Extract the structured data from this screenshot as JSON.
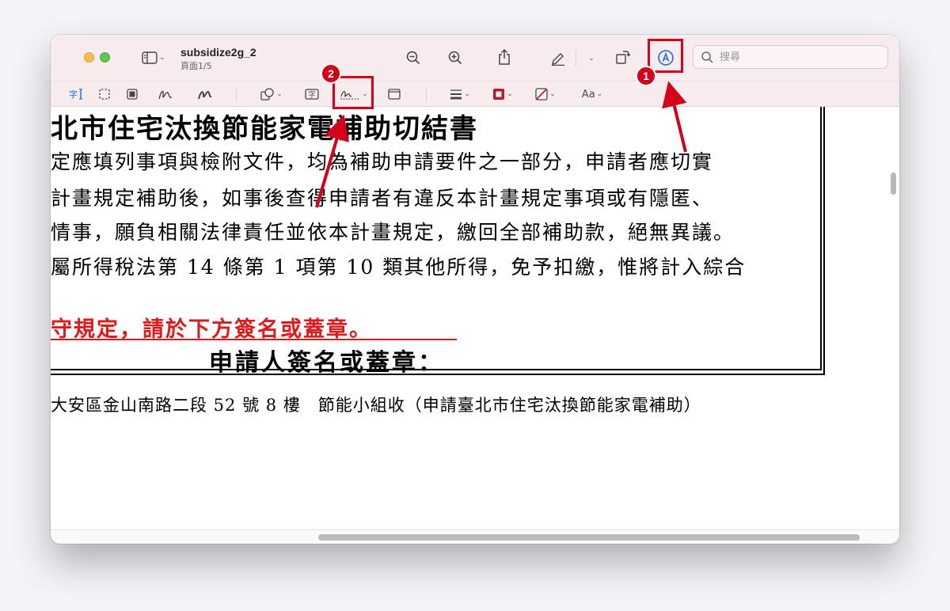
{
  "window": {
    "doc_title": "subsidize2g_2",
    "page_indicator": "頁面1/5",
    "search_placeholder": "搜尋"
  },
  "icons": {
    "sidebar": "sidebar-icon",
    "zoom_out": "zoom-out-icon",
    "zoom_in": "zoom-in-icon",
    "share": "share-icon",
    "highlight": "highlighter-icon",
    "rotate": "rotate-icon",
    "markup": "markup-pen-icon",
    "search": "search-icon"
  },
  "markup_toolbar": {
    "font_button": "Aa"
  },
  "document": {
    "heading": "北市住宅汰換節能家電補助切結書",
    "para1": "定應填列事項與檢附文件，均為補助申請要件之一部分，申請者應切實",
    "para2": "計畫規定補助後，如事後查得申請者有違反本計畫規定事項或有隱匿、",
    "para3": "情事，願負相關法律責任並依本計畫規定，繳回全部補助款，絕無異議。",
    "para4": "屬所得稅法第 14 條第 1 項第 10 類其他所得，免予扣繳，惟將計入綜合",
    "red_notice": "守規定，請於下方簽名或蓋章。",
    "signer_label": "申請人簽名或蓋章：",
    "address": "大安區金山南路二段 52 號 8 樓　節能小組收（申請臺北市住宅汰換節能家電補助）"
  },
  "annotations": {
    "badge1": "1",
    "badge2": "2",
    "accent": "#d4001a"
  }
}
